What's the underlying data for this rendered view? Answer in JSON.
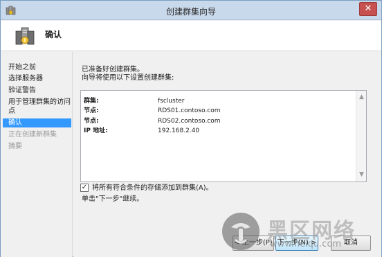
{
  "window": {
    "title": "创建群集向导",
    "close_glyph": "✕"
  },
  "header": {
    "title": "确认"
  },
  "nav": {
    "items": [
      {
        "label": "开始之前",
        "state": "normal"
      },
      {
        "label": "选择服务器",
        "state": "normal"
      },
      {
        "label": "验证警告",
        "state": "normal"
      },
      {
        "label": "用于管理群集的访问",
        "state": "normal"
      },
      {
        "label": "点",
        "state": "normal"
      },
      {
        "label": "确认",
        "state": "active"
      },
      {
        "label": "正在创建新群集",
        "state": "disabled"
      },
      {
        "label": "摘要",
        "state": "disabled"
      }
    ]
  },
  "content": {
    "intro_line1": "已准备好创建群集。",
    "intro_line2": "向导将使用以下设置创建群集:",
    "summary_rows": [
      {
        "label": "群集:",
        "value": "fscluster"
      },
      {
        "label": "节点:",
        "value": "RDS01.contoso.com"
      },
      {
        "label": "节点:",
        "value": "RDS02.contoso.com"
      },
      {
        "label": "IP 地址:",
        "value": "192.168.2.40"
      }
    ],
    "checkbox": {
      "checked": true,
      "mark": "✓",
      "label": "将所有符合条件的存储添加到群集(A)。"
    },
    "hint": "单击\"下一步\"继续。"
  },
  "buttons": {
    "prev": "< 上一步(P)",
    "next": "下一步(N) >",
    "cancel": "取消"
  },
  "watermark": {
    "title": "黑区网络",
    "url": "www.heiqu.com"
  },
  "colors": {
    "accent": "#3399ff",
    "titlebar": "#c9d9ec",
    "close": "#c75050"
  },
  "icons": {
    "app": "cluster-app-icon",
    "header": "cluster-servers-icon",
    "watermark": "heiqu-logo-icon"
  }
}
